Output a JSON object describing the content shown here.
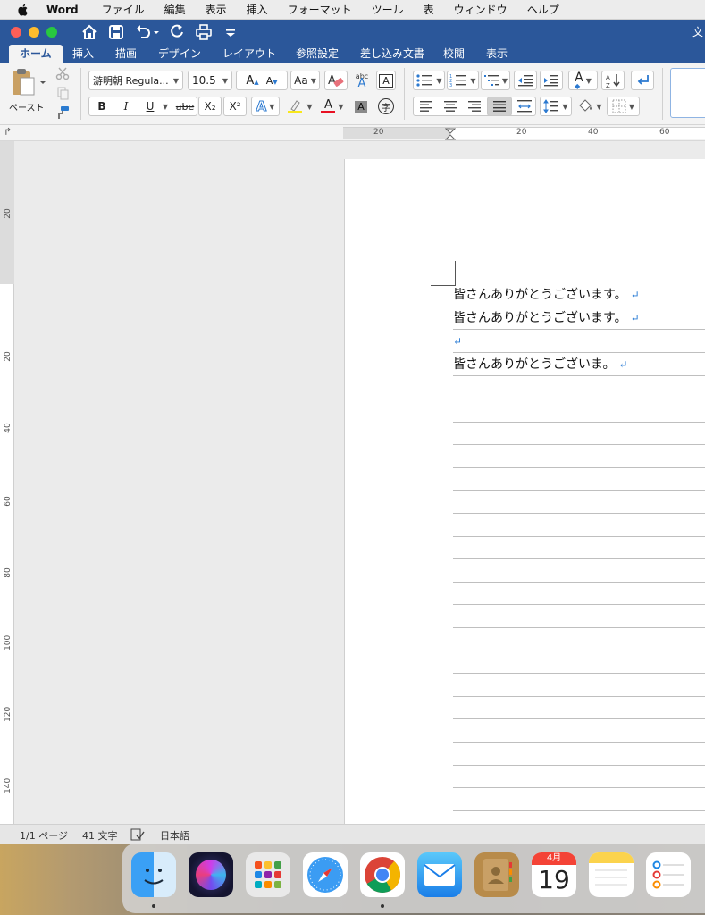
{
  "menubar": {
    "app": "Word",
    "items": [
      "ファイル",
      "編集",
      "表示",
      "挿入",
      "フォーマット",
      "ツール",
      "表",
      "ウィンドウ",
      "ヘルプ"
    ]
  },
  "titlebar": {
    "title_fragment": "文"
  },
  "tabs": [
    "ホーム",
    "挿入",
    "描画",
    "デザイン",
    "レイアウト",
    "参照設定",
    "差し込み文書",
    "校閲",
    "表示"
  ],
  "ribbon": {
    "paste_label": "ペースト",
    "font_name": "游明朝 Regula...",
    "font_size": "10.5",
    "bold": "B",
    "italic": "I",
    "underline": "U",
    "strike": "abe",
    "subscript": "X₂",
    "superscript": "X²",
    "font_color_glyph": "A",
    "phonetic_glyph": "字",
    "abc_glyph": "abc"
  },
  "ruler": {
    "ticks": [
      "20",
      "20",
      "40",
      "60"
    ]
  },
  "vruler": {
    "ticks": [
      "20",
      "20",
      "40",
      "60",
      "80",
      "100",
      "120",
      "140"
    ]
  },
  "document": {
    "lines": [
      "皆さんありがとうございます。",
      "皆さんありがとうございます。",
      "",
      "皆さんありがとうございま。"
    ],
    "return_mark": "↵"
  },
  "statusbar": {
    "page": "1/1 ページ",
    "words": "41 文字",
    "language": "日本語"
  },
  "dock": {
    "calendar_month": "4月",
    "calendar_day": "19"
  },
  "colors": {
    "word_blue": "#2b579a",
    "return_mark": "#2f7fd6"
  }
}
